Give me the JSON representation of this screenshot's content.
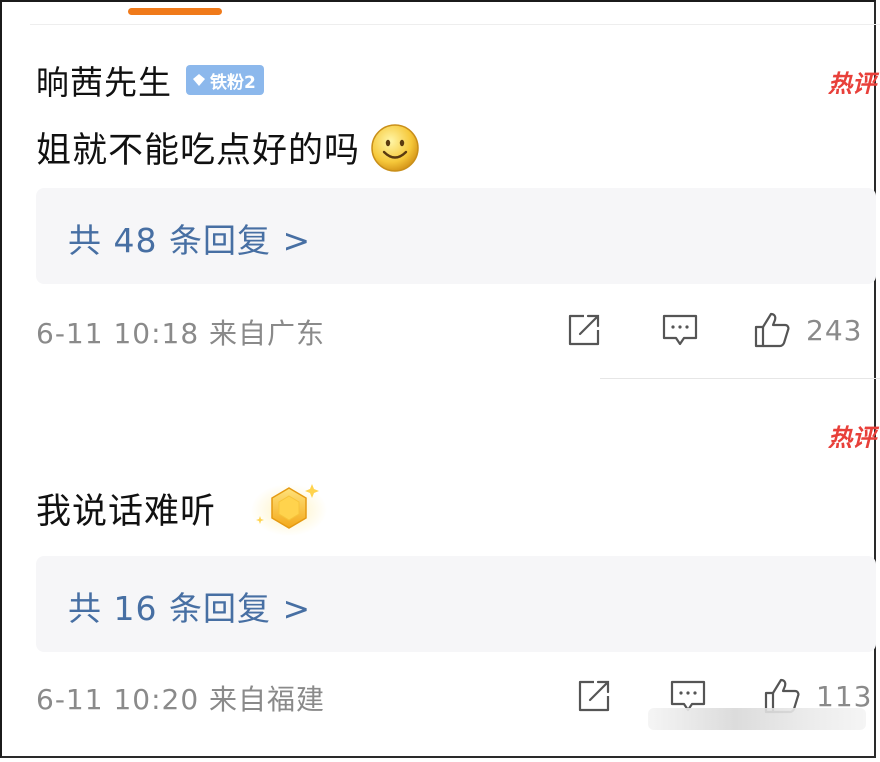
{
  "comments": [
    {
      "username": "晌茜先生",
      "badge_label": "铁粉2",
      "hot_label": "热评",
      "text": "姐就不能吃点好的吗",
      "emoji": "smiley-emoji",
      "reply_link": "共 48 条回复 >",
      "meta": "6-11 10:18  来自广东",
      "like_count": "243"
    },
    {
      "hot_label": "热评",
      "text": "我说话难听",
      "emoji": "gold-medal-badge",
      "reply_link": "共 16 条回复 >",
      "meta": "6-11 10:20  来自福建",
      "like_count": "113"
    }
  ],
  "colors": {
    "accent_orange": "#f07a1a",
    "link_blue": "#476fa3",
    "hot_red": "#e8403a",
    "badge_blue": "#8cb8ec",
    "meta_gray": "#8a8a8a"
  },
  "icons": [
    "share-icon",
    "comment-icon",
    "thumbs-up-icon",
    "diamond-icon"
  ]
}
